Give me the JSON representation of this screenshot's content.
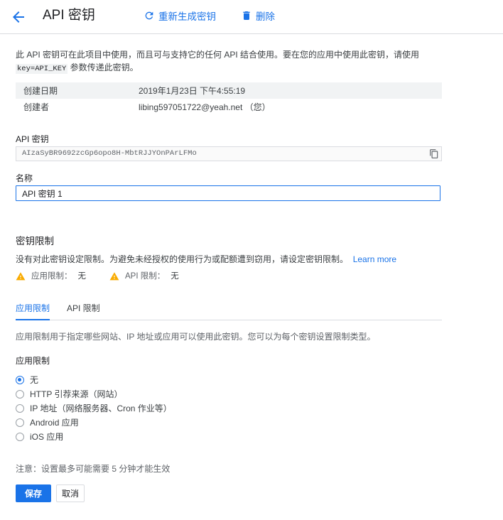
{
  "header": {
    "title": "API 密钥",
    "regenerate_label": "重新生成密钥",
    "delete_label": "删除"
  },
  "intro": {
    "line1": "此 API 密钥可在此项目中使用，而且可与支持它的任何 API 结合使用。要在您的应用中使用此密钥，请使用",
    "code": "key=API_KEY",
    "line2_suffix": " 参数传递此密钥。"
  },
  "info": [
    {
      "label": "创建日期",
      "value": "2019年1月23日 下午4:55:19"
    },
    {
      "label": "创建者",
      "value": "libing597051722@yeah.net （您）"
    }
  ],
  "api_key": {
    "label": "API 密钥",
    "value": "AIzaSyBR9692zcGp6opo8H-MbtRJJYOnPArLFMo"
  },
  "name_field": {
    "label": "名称",
    "value": "API 密钥 1"
  },
  "key_restrictions": {
    "title": "密钥限制",
    "description": "没有对此密钥设定限制。为避免未经授权的使用行为或配额遭到窃用，请设定密钥限制。",
    "learn_more": "Learn more",
    "warnings": [
      {
        "label": "应用限制：",
        "value": "无"
      },
      {
        "label": "API 限制：",
        "value": "无"
      }
    ]
  },
  "tabs": [
    {
      "label": "应用限制",
      "active": true
    },
    {
      "label": "API 限制",
      "active": false
    }
  ],
  "app_restrictions": {
    "description": "应用限制用于指定哪些网站、IP 地址或应用可以使用此密钥。您可以为每个密钥设置限制类型。",
    "group_label": "应用限制",
    "options": [
      {
        "label": "无",
        "checked": true
      },
      {
        "label": "HTTP 引荐来源（网站）",
        "checked": false
      },
      {
        "label": "IP 地址（网络服务器、Cron 作业等）",
        "checked": false
      },
      {
        "label": "Android 应用",
        "checked": false
      },
      {
        "label": "iOS 应用",
        "checked": false
      }
    ]
  },
  "note": "注意：设置最多可能需要 5 分钟才能生效",
  "actions": {
    "save": "保存",
    "cancel": "取消"
  },
  "colors": {
    "accent": "#1a73e8",
    "warning": "#f9ab00"
  }
}
